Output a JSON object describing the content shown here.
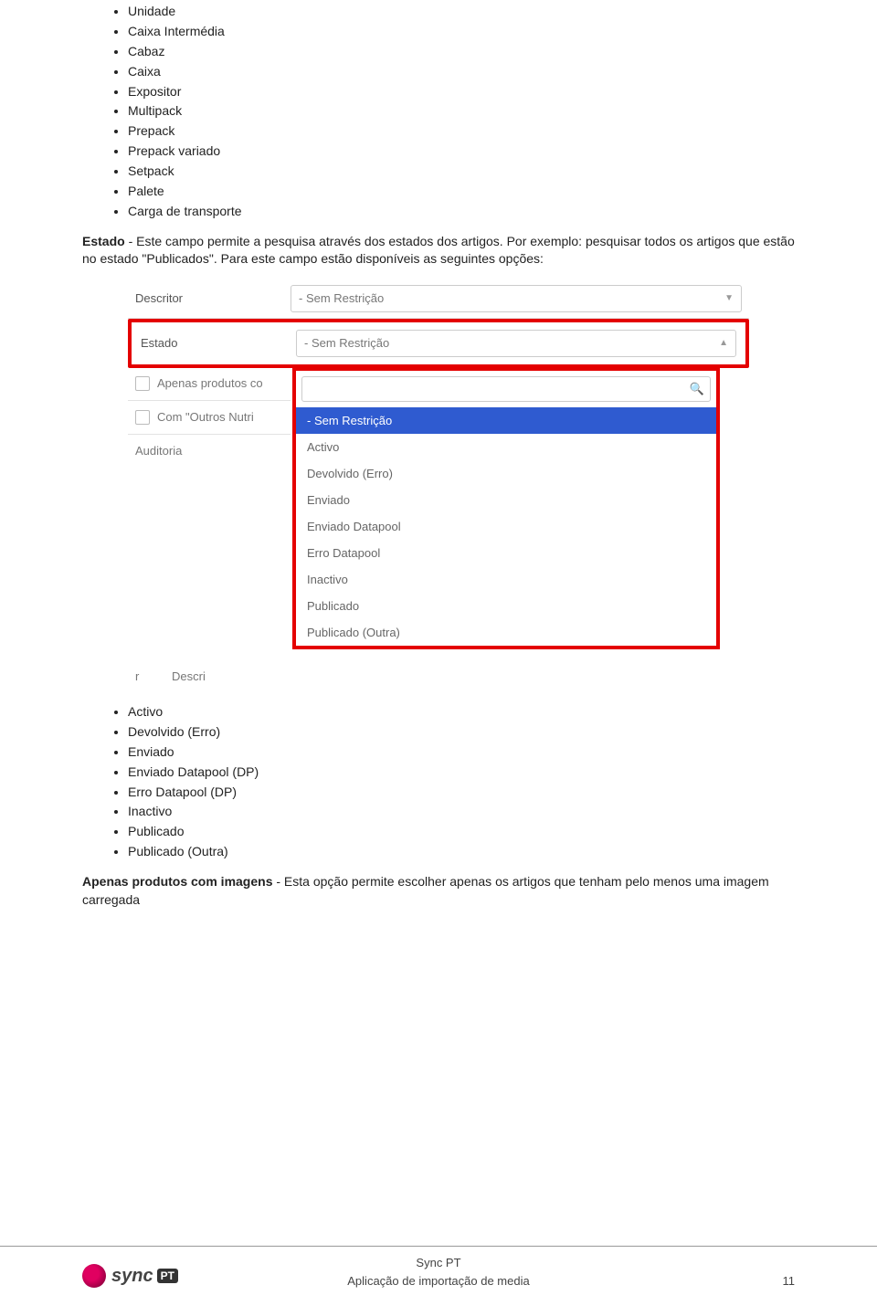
{
  "list1": [
    "Unidade",
    "Caixa Intermédia",
    "Cabaz",
    "Caixa",
    "Expositor",
    "Multipack",
    "Prepack",
    "Prepack variado",
    "Setpack",
    "Palete",
    "Carga de transporte"
  ],
  "para_estado": {
    "label": "Estado",
    "rest": " - Este campo permite a pesquisa através dos estados dos artigos. Por exemplo: pesquisar todos os artigos que estão no estado \"Publicados\". Para este campo estão disponíveis as seguintes opções:"
  },
  "shot": {
    "descritor_label": "Descritor",
    "descritor_value": "- Sem Restrição",
    "estado_label": "Estado",
    "estado_value": "- Sem Restrição",
    "chk1_text": "Apenas produtos co",
    "chk2_text": "Com \"Outros Nutri",
    "auditoria_label": "Auditoria",
    "search_placeholder": "",
    "options": [
      "- Sem Restrição",
      "Activo",
      "Devolvido (Erro)",
      "Enviado",
      "Enviado Datapool",
      "Erro Datapool",
      "Inactivo",
      "Publicado",
      "Publicado (Outra)"
    ],
    "bottom_left": "r",
    "bottom_right": "Descri"
  },
  "list2": [
    "Activo",
    "Devolvido (Erro)",
    "Enviado",
    "Enviado Datapool (DP)",
    "Erro Datapool (DP)",
    "Inactivo",
    "Publicado",
    "Publicado (Outra)"
  ],
  "para_imagens": {
    "label": "Apenas produtos com imagens",
    "rest": " - Esta opção permite escolher apenas os artigos que tenham pelo menos uma imagem carregada"
  },
  "footer": {
    "line1": "Sync PT",
    "line2": "Aplicação de importação de media",
    "page": "11",
    "logo_text": "sync",
    "logo_badge": "PT"
  }
}
